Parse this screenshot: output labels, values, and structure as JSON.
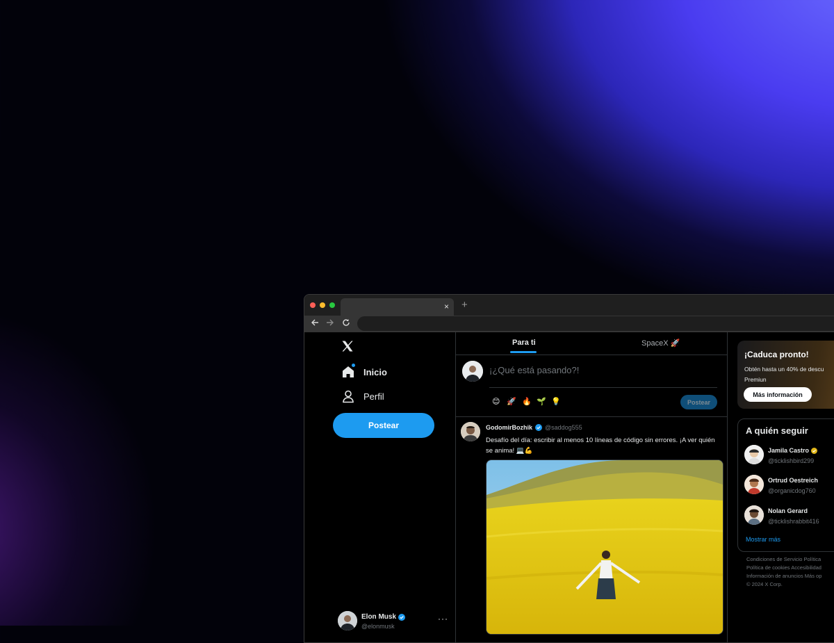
{
  "feed_tabs": {
    "for_you": "Para ti",
    "spacex": "SpaceX 🚀"
  },
  "sidebar": {
    "items": [
      {
        "label": "Inicio"
      },
      {
        "label": "Perfil"
      }
    ],
    "post_button": "Postear",
    "account": {
      "name": "Elon Musk",
      "handle": "@elonmusk"
    },
    "more": "···"
  },
  "composer": {
    "placeholder": "¡¿Qué está pasando?!",
    "emojis": [
      "😊",
      "🚀",
      "🔥",
      "🌱",
      "💡"
    ],
    "post_button": "Postear"
  },
  "tweet": {
    "name": "GodomirBozhik",
    "handle": "@saddog555",
    "text": "Desafío del día: escribir al menos 10 líneas de código sin errores. ¡A ver quién se anima! 💻💪"
  },
  "promo": {
    "title": "¡Caduca pronto!",
    "text_line1": "Obtén hasta un 40% de descu",
    "text_line2": "Premiun",
    "button": "Más información"
  },
  "who_to_follow": {
    "title": "A quién seguir",
    "users": [
      {
        "name": "Jamila Castro",
        "handle": "@ticklishbird299"
      },
      {
        "name": "Ortrud Oestreich",
        "handle": "@organicdog760"
      },
      {
        "name": "Nolan Gerard",
        "handle": "@ticklishrabbit416"
      }
    ],
    "show_more": "Mostrar más"
  },
  "footer": [
    "Condiciones de Servicio   Política",
    "Política de cookies   Accesibilidad",
    "Información de anuncios   Más op",
    "© 2024 X Corp."
  ],
  "browser": {
    "tab_close": "×",
    "new_tab": "+"
  },
  "colors": {
    "accent": "#1d9bf0",
    "background": "#000000",
    "verified": "#1d9bf0",
    "gold_verified": "#e2b719"
  }
}
